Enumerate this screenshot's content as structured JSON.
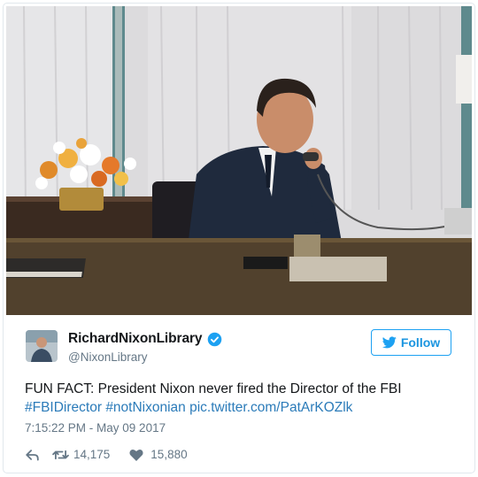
{
  "user": {
    "display_name": "RichardNixonLibrary",
    "handle": "@NixonLibrary",
    "verified": true
  },
  "follow_button": {
    "label": "Follow"
  },
  "tweet": {
    "text": "FUN FACT: President Nixon never fired the Director of the FBI",
    "hashtags": [
      "#FBIDirector",
      "#notNixonian"
    ],
    "media_link": "pic.twitter.com/PatArKOZlk",
    "timestamp": "7:15:22 PM - May 09 2017"
  },
  "stats": {
    "retweets": "14,175",
    "likes": "15,880"
  },
  "icons": {
    "verified": "verified-badge-icon",
    "follow_bird": "twitter-bird-icon",
    "reply": "reply-icon",
    "retweet": "retweet-icon",
    "like": "heart-icon"
  },
  "colors": {
    "link": "#2b7bb9",
    "accent": "#1da1f2",
    "secondary_text": "#657786"
  }
}
